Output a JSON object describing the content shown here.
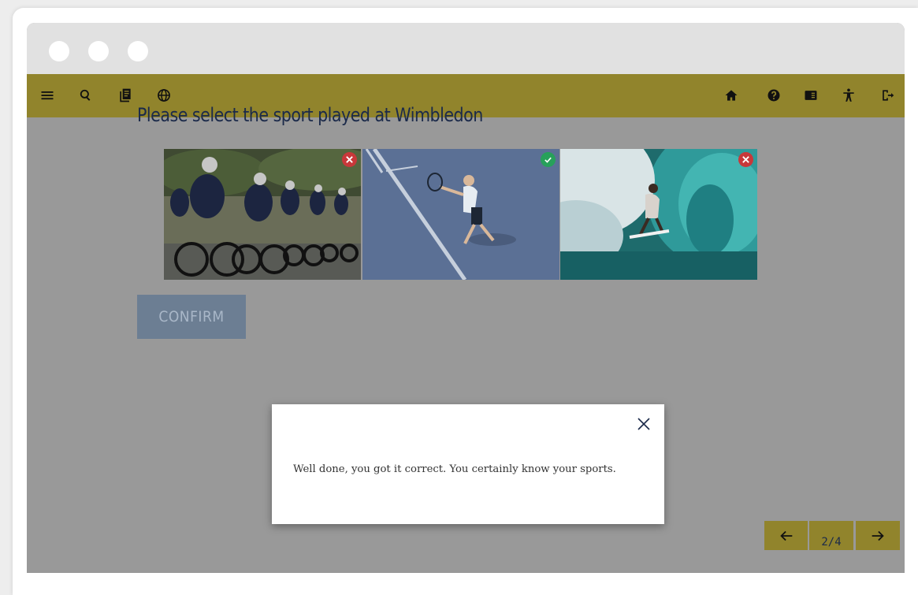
{
  "window": {
    "controls": [
      "close",
      "minimize",
      "maximize"
    ]
  },
  "toolbar": {
    "left_icons": [
      "menu-icon",
      "search-icon",
      "glossary-icon",
      "language-icon"
    ],
    "right_icons": [
      "home-icon",
      "help-icon",
      "resources-icon",
      "accessibility-icon",
      "exit-icon"
    ],
    "color": "#91842c"
  },
  "question": {
    "title": "Please select the sport played at Wimbledon"
  },
  "options": [
    {
      "label": "Cycling",
      "status": "incorrect",
      "status_icon": "cross-icon"
    },
    {
      "label": "Tennis",
      "status": "correct",
      "selected": true,
      "status_icon": "check-icon"
    },
    {
      "label": "Surfing",
      "status": "incorrect",
      "status_icon": "cross-icon"
    }
  ],
  "confirm": {
    "label": "CONFIRM"
  },
  "feedback": {
    "message": "Well done, you got it correct. You certainly know your sports."
  },
  "pager": {
    "current": "2/4"
  },
  "colors": {
    "correct": "#27a05a",
    "incorrect": "#c8383a",
    "text_dark": "#1b2a4a"
  }
}
